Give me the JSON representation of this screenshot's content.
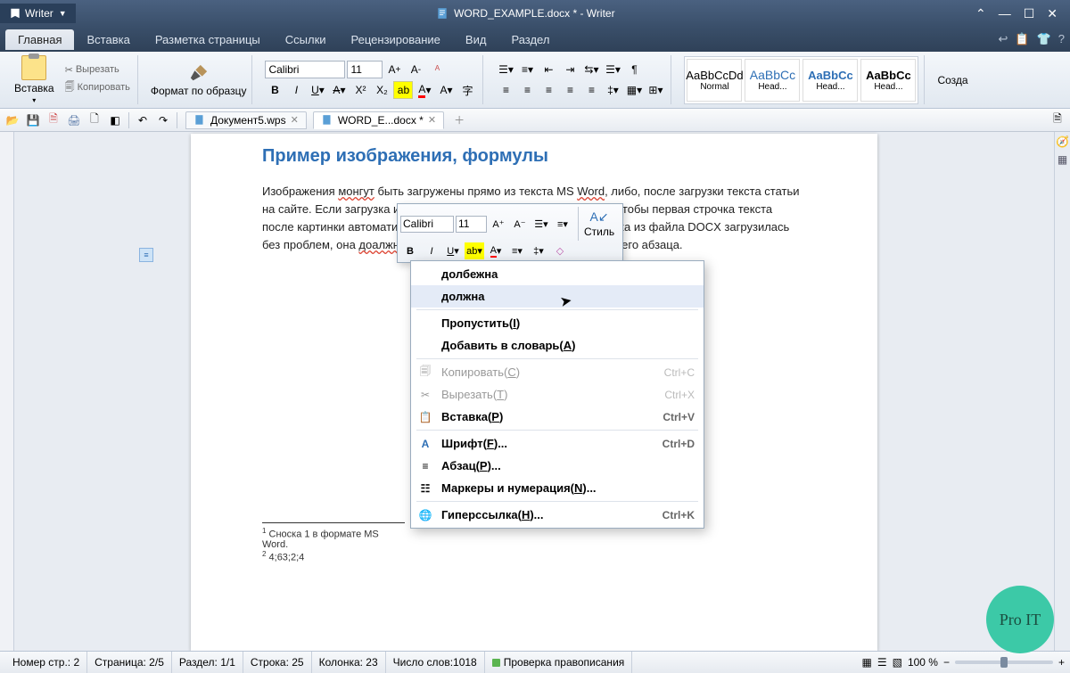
{
  "titlebar": {
    "app": "Writer",
    "title": "WORD_EXAMPLE.docx * - Writer"
  },
  "menu": {
    "tabs": [
      "Главная",
      "Вставка",
      "Разметка страницы",
      "Ссылки",
      "Рецензирование",
      "Вид",
      "Раздел"
    ]
  },
  "ribbon": {
    "paste": "Вставка",
    "cut": "Вырезать",
    "copy": "Копировать",
    "format_painter": "Формат по образцу",
    "font_name": "Calibri",
    "font_size": "11",
    "styles": [
      {
        "preview": "AaBbCcDd",
        "name": "Normal",
        "cls": ""
      },
      {
        "preview": "AaBbCc",
        "name": "Head...",
        "cls": "h1"
      },
      {
        "preview": "AaBbCc",
        "name": "Head...",
        "cls": "h2"
      },
      {
        "preview": "AaBbCc",
        "name": "Head...",
        "cls": "h3"
      }
    ],
    "create": "Созда"
  },
  "doc_tabs": [
    {
      "label": "Документ5.wps",
      "active": false
    },
    {
      "label": "WORD_E...docx *",
      "active": true
    }
  ],
  "page": {
    "heading": "Пример изображения, формулы",
    "para": "Изображения монгут быть загружены прямо из текста MS Word, либо, после загрузки текста статьи на сайте. Если загрузка изображения была из текста, то следите чтобы первая строчка текста после картинки автоматически не стала названием. Чтобы картинка из файла DOCX загрузилась без проблем, она доалжна отделятся пустой строкой от предыдущего абзаца.",
    "footnote1": "Сноска 1 в формате MS Word.",
    "footnote2": "4;63;2;4"
  },
  "mini": {
    "font": "Calibri",
    "size": "11",
    "style": "Стиль"
  },
  "ctx": {
    "sugg1": "долбежна",
    "sugg2": "должна",
    "skip": "Пропустить(",
    "skip_k": "I",
    "skip_end": ")",
    "add": "Добавить в словарь(",
    "add_k": "A",
    "add_end": ")",
    "copy": "Копировать(",
    "copy_k": "C",
    "copy_end": ")",
    "copy_sc": "Ctrl+C",
    "cut": "Вырезать(",
    "cut_k": "T",
    "cut_end": ")",
    "cut_sc": "Ctrl+X",
    "paste": "Вставка(",
    "paste_k": "P",
    "paste_end": ")",
    "paste_sc": "Ctrl+V",
    "font": "Шрифт(",
    "font_k": "F",
    "font_end": ")...",
    "font_sc": "Ctrl+D",
    "para": "Абзац(",
    "para_k": "P",
    "para_end": ")...",
    "bullets": "Маркеры и нумерация(",
    "bullets_k": "N",
    "bullets_end": ")...",
    "link": "Гиперссылка(",
    "link_k": "H",
    "link_end": ")...",
    "link_sc": "Ctrl+K"
  },
  "status": {
    "page_no": "Номер стр.: 2",
    "page": "Страница: 2/5",
    "section": "Раздел: 1/1",
    "line": "Строка: 25",
    "col": "Колонка: 23",
    "words": "Число слов:1018",
    "spell": "Проверка правописания",
    "zoom": "100 %"
  },
  "logo": "Pro IT"
}
